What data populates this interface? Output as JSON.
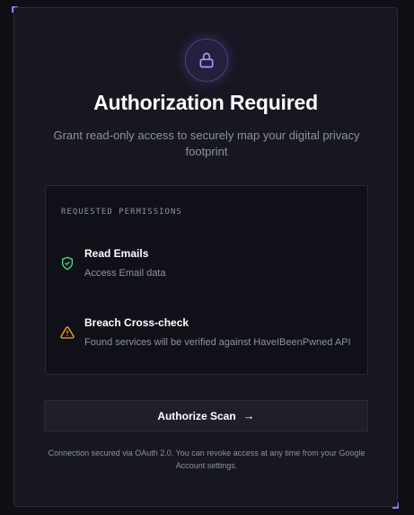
{
  "header": {
    "lock_icon": "lock-icon",
    "title": "Authorization Required",
    "subtitle": "Grant read-only access to securely map your digital privacy footprint"
  },
  "permissions": {
    "heading": "REQUESTED PERMISSIONS",
    "items": [
      {
        "icon": "shield-check-icon",
        "title": "Read Emails",
        "description": "Access Email data",
        "icon_color": "#4ade80"
      },
      {
        "icon": "warning-icon",
        "title": "Breach Cross-check",
        "description": "Found services will be verified against HaveIBeenPwned API",
        "icon_color": "#f5a524"
      }
    ]
  },
  "action": {
    "label": "Authorize Scan",
    "icon": "arrow-right-icon"
  },
  "footer": {
    "text": "Connection secured via OAuth 2.0. You can revoke access at any time from your Google Account settings."
  },
  "colors": {
    "accent": "#8a7cf0",
    "success": "#4ade80",
    "warning": "#f5a524"
  }
}
